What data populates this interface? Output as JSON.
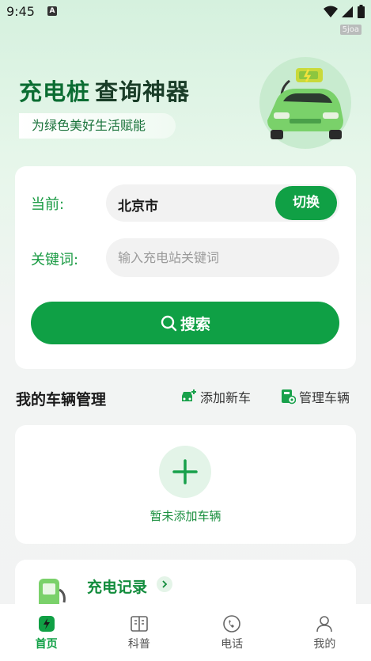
{
  "status_bar": {
    "time": "9:45",
    "notification_letter": "A",
    "watermark": "5joa"
  },
  "hero": {
    "title_green": "充电桩",
    "title_dark": "查询神器",
    "subtitle": "为绿色美好生活赋能"
  },
  "search": {
    "current_label": "当前:",
    "city": "北京市",
    "switch_label": "切换",
    "keyword_label": "关键词:",
    "keyword_value": "",
    "keyword_placeholder": "输入充电站关键词",
    "search_button": "搜索"
  },
  "vehicles": {
    "section_title": "我的车辆管理",
    "add_car_label": "添加新车",
    "manage_car_label": "管理车辆",
    "empty_text": "暂未添加车辆"
  },
  "record": {
    "title": "充电记录"
  },
  "nav": {
    "items": [
      {
        "label": "首页",
        "icon": "home-bolt-icon",
        "active": true
      },
      {
        "label": "科普",
        "icon": "book-icon",
        "active": false
      },
      {
        "label": "电话",
        "icon": "phone-icon",
        "active": false
      },
      {
        "label": "我的",
        "icon": "user-icon",
        "active": false
      }
    ]
  },
  "colors": {
    "accent": "#10a045",
    "title_green": "#0b6d32",
    "label_green": "#189a42"
  }
}
